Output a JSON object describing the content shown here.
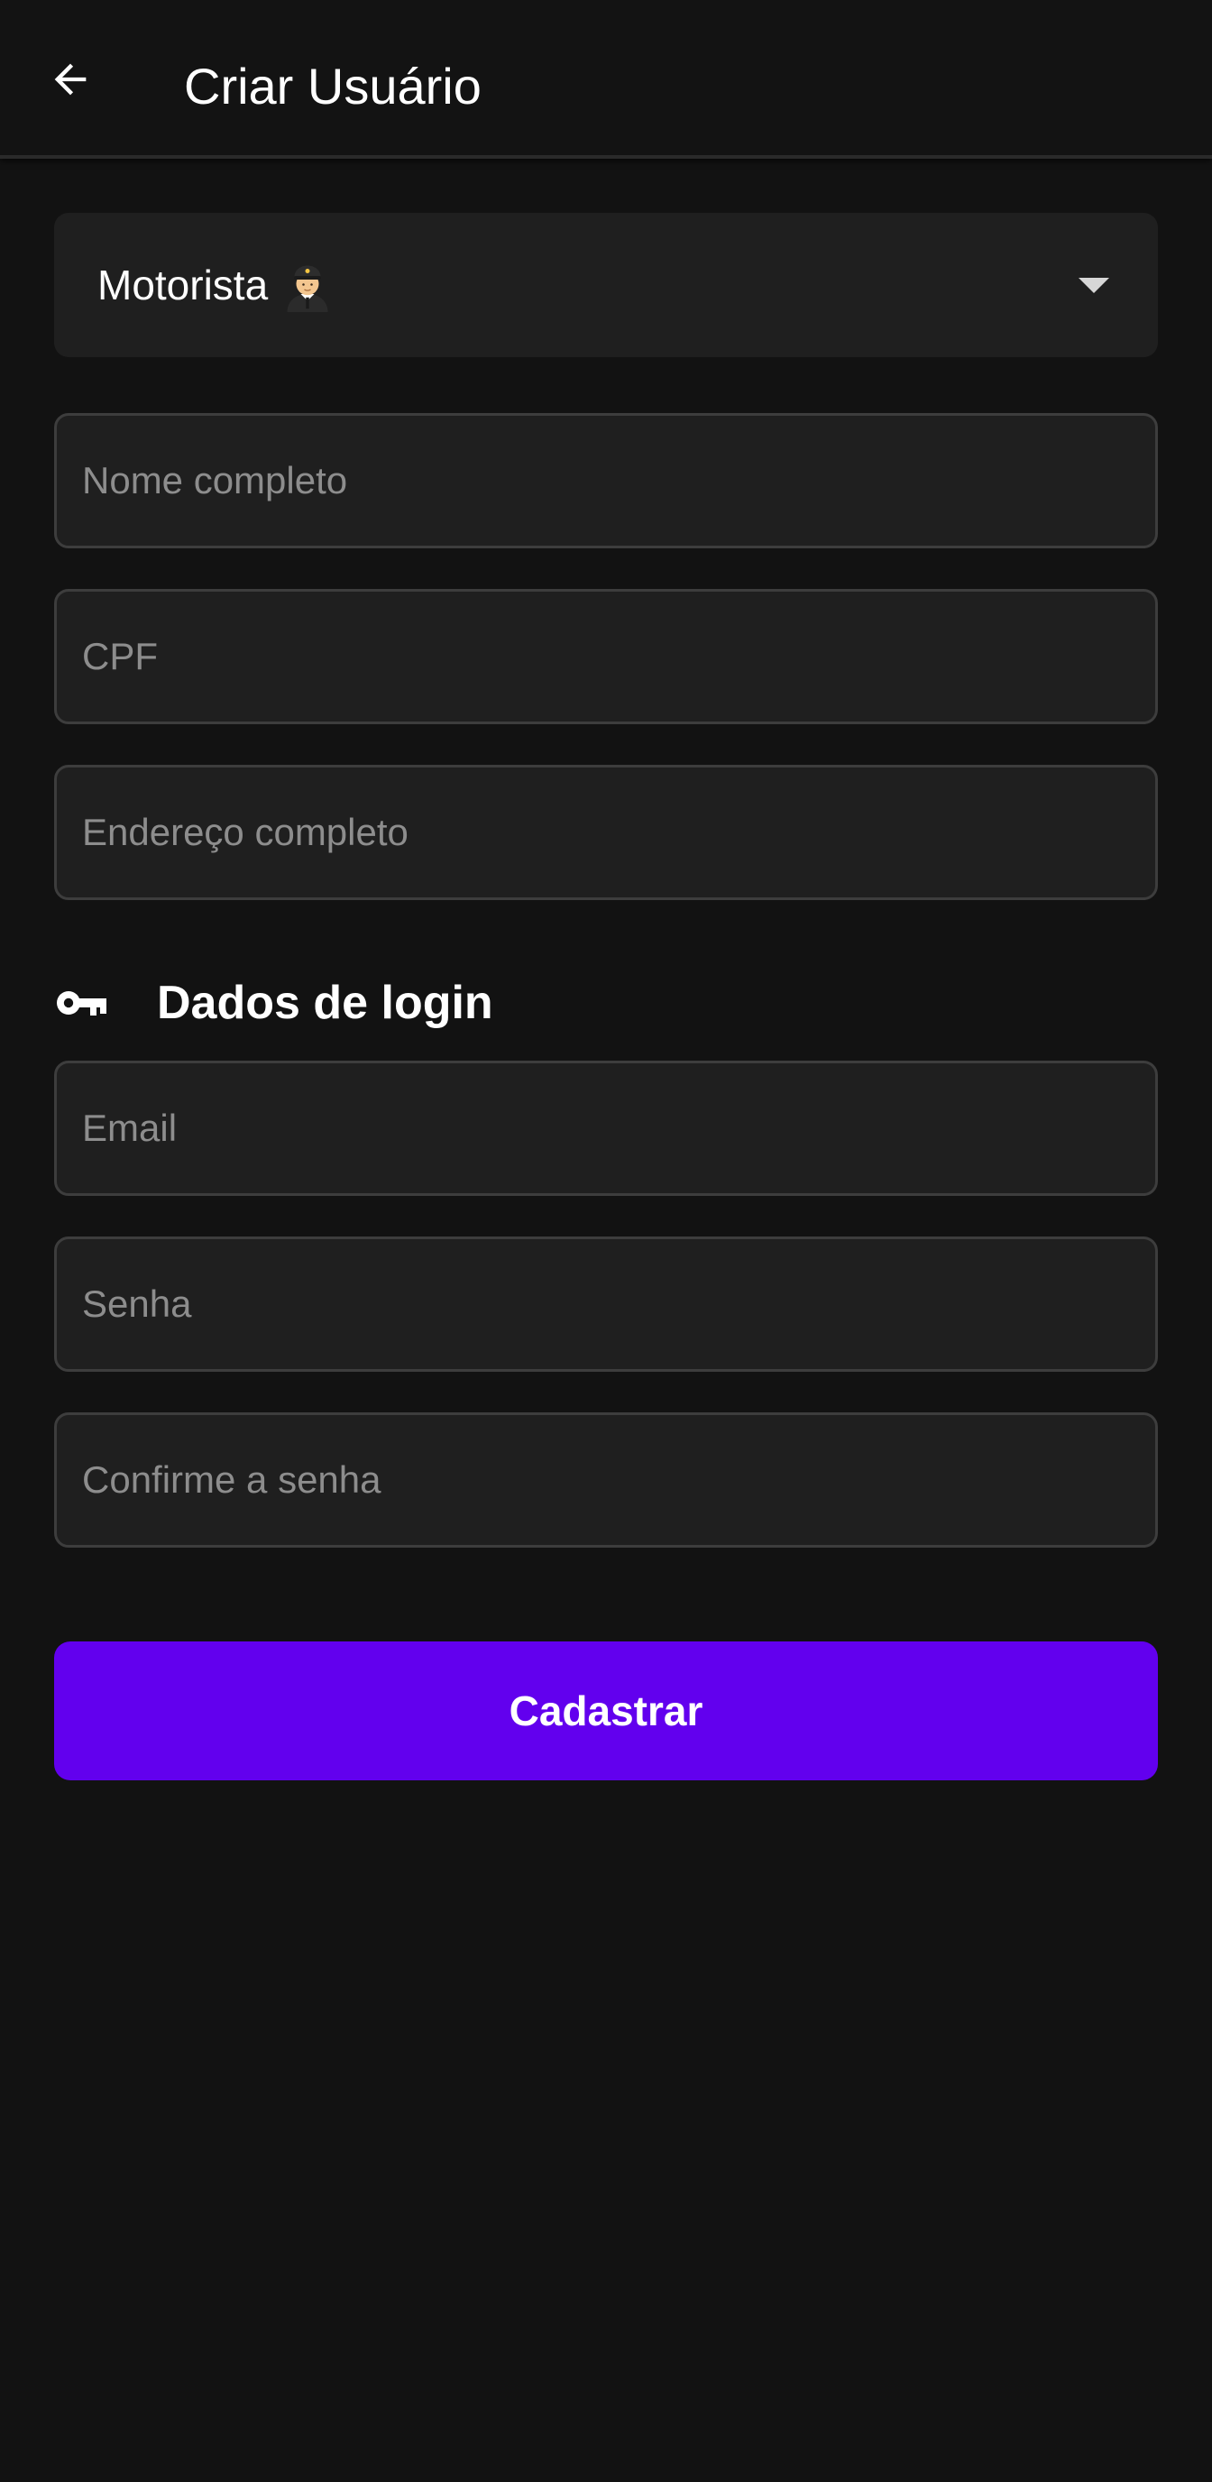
{
  "header": {
    "title": "Criar Usuário",
    "back_icon": "arrow-back-icon"
  },
  "user_type_select": {
    "selected_label": "Motorista",
    "selected_emoji_icon": "pilot-emoji-icon"
  },
  "personal_fields": {
    "full_name": {
      "placeholder": "Nome completo",
      "value": ""
    },
    "cpf": {
      "placeholder": "CPF",
      "value": ""
    },
    "address": {
      "placeholder": "Endereço completo",
      "value": ""
    }
  },
  "login_section": {
    "icon": "key-icon",
    "title": "Dados de login",
    "email": {
      "placeholder": "Email",
      "value": ""
    },
    "password": {
      "placeholder": "Senha",
      "value": ""
    },
    "confirm_password": {
      "placeholder": "Confirme a senha",
      "value": ""
    }
  },
  "submit": {
    "label": "Cadastrar"
  },
  "colors": {
    "background": "#121212",
    "field_background": "#1f1f1f",
    "field_border": "#3d3d3d",
    "placeholder": "#8d8d8d",
    "accent": "#6200ee"
  }
}
